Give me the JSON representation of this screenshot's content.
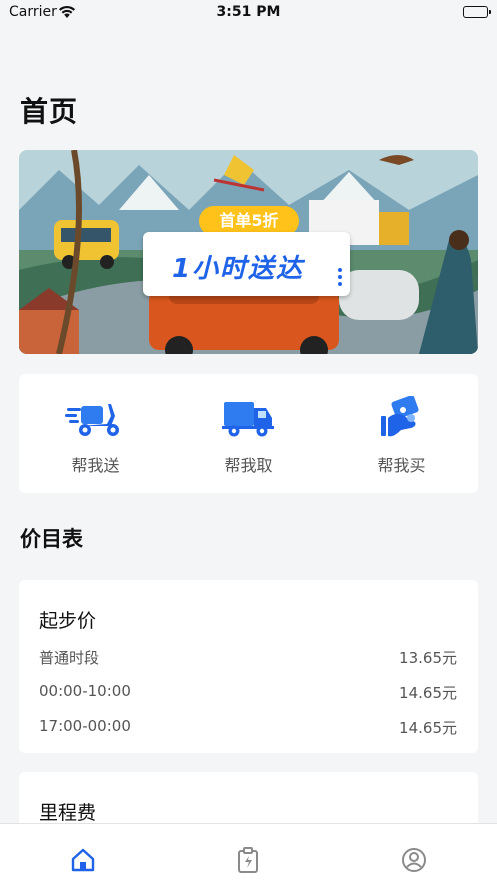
{
  "status_bar": {
    "carrier": "Carrier",
    "time": "3:51 PM"
  },
  "page": {
    "title": "首页"
  },
  "banner": {
    "promo_tag": "首单5折",
    "headline": "1小时送达"
  },
  "services": [
    {
      "label": "帮我送",
      "icon": "scooter-delivery-icon"
    },
    {
      "label": "帮我取",
      "icon": "truck-icon"
    },
    {
      "label": "帮我买",
      "icon": "shopping-hand-icon"
    }
  ],
  "price_section": {
    "title": "价目表"
  },
  "price_cards": [
    {
      "title": "起步价",
      "rows": [
        {
          "label": "普通时段",
          "value": "13.65元"
        },
        {
          "label": "00:00-10:00",
          "value": "14.65元"
        },
        {
          "label": "17:00-00:00",
          "value": "14.65元"
        }
      ]
    },
    {
      "title": "里程费",
      "rows": []
    }
  ],
  "tab_bar": {
    "items": [
      {
        "icon": "home-icon",
        "active": true
      },
      {
        "icon": "orders-icon",
        "active": false
      },
      {
        "icon": "profile-icon",
        "active": false
      }
    ],
    "active_color": "#1f63e8",
    "inactive_color": "#8a8a8a"
  },
  "colors": {
    "accent": "#1f63e8",
    "promo": "#ffc21a",
    "background": "#f4f5f7"
  }
}
